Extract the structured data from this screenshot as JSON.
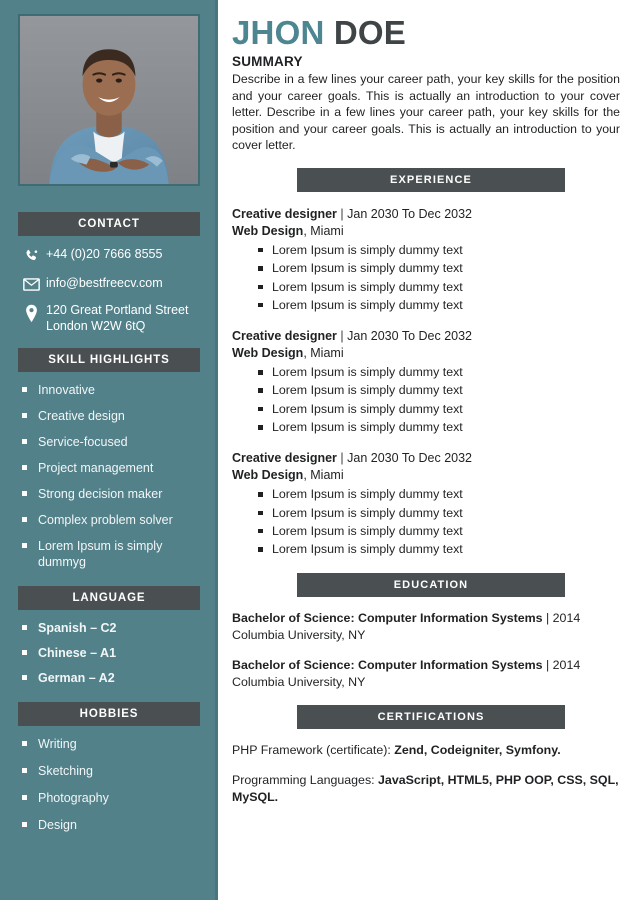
{
  "sidebar": {
    "photo_alt": "profile-photo",
    "sections": {
      "contact_title": "CONTACT",
      "skills_title": "SKILL HIGHLIGHTS",
      "language_title": "LANGUAGE",
      "hobbies_title": "HOBBIES"
    },
    "contact": [
      {
        "icon": "phone-icon",
        "text": "+44 (0)20 7666 8555"
      },
      {
        "icon": "envelope-icon",
        "text": "info@bestfreecv.com"
      },
      {
        "icon": "location-pin-icon",
        "text": "120 Great Portland Street London W2W 6tQ"
      }
    ],
    "skills": [
      "Innovative",
      "Creative design",
      "Service-focused",
      "Project management",
      "Strong decision maker",
      "Complex problem solver",
      "Lorem Ipsum is simply dummyg"
    ],
    "languages": [
      "Spanish – C2",
      "Chinese – A1",
      "German – A2"
    ],
    "hobbies": [
      "Writing",
      "Sketching",
      "Photography",
      "Design"
    ]
  },
  "main": {
    "name_first": "JHON",
    "name_last": "DOE",
    "summary_title": "SUMMARY",
    "summary_body": "Describe in a few lines your career path, your key skills for the position and your career goals. This is actually an introduction to your cover letter. Describe in a few lines your career path, your key skills for the position and your career goals. This is actually an introduction to your cover letter.",
    "experience_title": "EXPERIENCE",
    "education_title": "EDUCATION",
    "certifications_title": "CERTIFICATIONS",
    "experience": [
      {
        "role": "Creative designer",
        "separator": "|",
        "dates": "Jan 2030 To Dec 2032",
        "company": "Web Design",
        "city": ", Miami",
        "bullets": [
          "Lorem Ipsum is simply dummy text",
          "Lorem Ipsum is simply dummy text",
          "Lorem Ipsum is simply dummy text",
          "Lorem Ipsum is simply dummy text"
        ]
      },
      {
        "role": "Creative designer",
        "separator": "|",
        "dates": "Jan 2030 To Dec 2032",
        "company": "Web Design",
        "city": ", Miami",
        "bullets": [
          "Lorem Ipsum is simply dummy text",
          "Lorem Ipsum is simply dummy text",
          "Lorem Ipsum is simply dummy text",
          "Lorem Ipsum is simply dummy text"
        ]
      },
      {
        "role": "Creative designer",
        "separator": "|",
        "dates": "Jan 2030 To Dec 2032",
        "company": "Web Design",
        "city": ", Miami",
        "bullets": [
          "Lorem Ipsum is simply dummy text",
          "Lorem Ipsum is simply dummy text",
          "Lorem Ipsum is simply dummy text",
          "Lorem Ipsum is simply dummy text"
        ]
      }
    ],
    "education": [
      {
        "degree": "Bachelor of Science: Computer Information Systems",
        "separator": "|",
        "year": "2014",
        "school": "Columbia University, NY"
      },
      {
        "degree": "Bachelor of Science: Computer Information Systems",
        "separator": "|",
        "year": "2014",
        "school": "Columbia University, NY"
      }
    ],
    "certifications": [
      {
        "label": "PHP Framework (certificate): ",
        "value": "Zend, Codeigniter, Symfony."
      },
      {
        "label": "Programming Languages: ",
        "value": "JavaScript, HTML5, PHP OOP, CSS, SQL, MySQL."
      }
    ]
  },
  "colors": {
    "sidebar_teal": "#52818a",
    "bar_gray": "#4a4f51",
    "name_accent": "#4d8690",
    "name_dark": "#3f4447",
    "body_text": "#1f2123"
  }
}
